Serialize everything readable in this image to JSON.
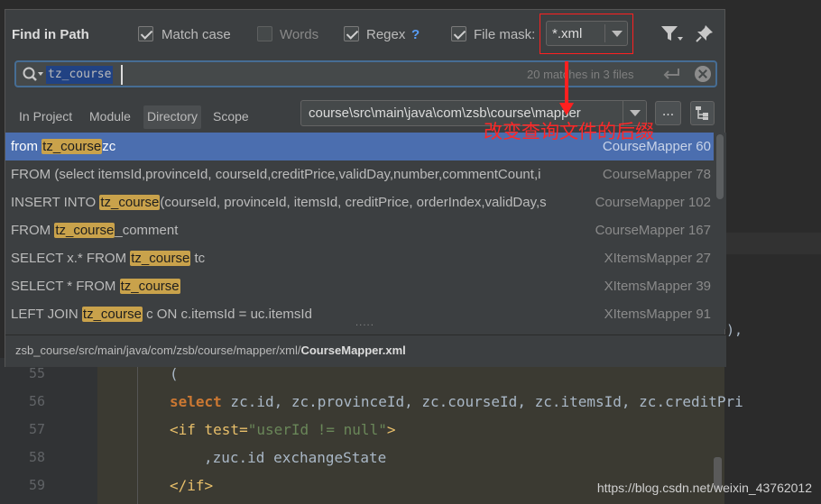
{
  "popup": {
    "title": "Find in Path",
    "options": [
      {
        "label": "Match case",
        "checked": true
      },
      {
        "label": "Words",
        "checked": false
      },
      {
        "label": "Regex",
        "checked": true
      },
      {
        "label": "File mask:",
        "checked": true
      }
    ],
    "regex_help": "?",
    "file_mask_value": "*.xml",
    "search": {
      "query": "tz_course",
      "count": "20 matches in 3 files"
    },
    "scopes": [
      {
        "label": "In Project",
        "selected": false
      },
      {
        "label": "Module",
        "selected": false
      },
      {
        "label": "Directory",
        "selected": true
      },
      {
        "label": "Scope",
        "selected": false
      }
    ],
    "directory_value": "course\\src\\main\\java\\com\\zsb\\course\\mapper",
    "browse_label": "...",
    "results": [
      {
        "pre": "from ",
        "match": "tz_course",
        "post": "zc",
        "file": "CourseMapper 60"
      },
      {
        "pre": "FROM (select itemsId,provinceId, courseId,creditPrice,validDay,number,commentCount,i",
        "match": "",
        "post": "",
        "file": "CourseMapper 78"
      },
      {
        "pre": "INSERT INTO ",
        "match": "tz_course",
        "post": "(courseId, provinceId, itemsId, creditPrice, orderIndex,validDay,s",
        "file": "CourseMapper 102"
      },
      {
        "pre": "FROM ",
        "match": "tz_course",
        "post": "_comment",
        "file": "CourseMapper 167"
      },
      {
        "pre": "SELECT x.* FROM ",
        "match": "tz_course",
        "post": " tc",
        "file": "XItemsMapper 27"
      },
      {
        "pre": "SELECT * FROM ",
        "match": "tz_course",
        "post": "",
        "file": "XItemsMapper 39"
      },
      {
        "pre": "LEFT JOIN ",
        "match": "tz_course",
        "post": " c ON c.itemsId = uc.itemsId",
        "file": "XItemsMapper 91"
      }
    ],
    "path_prefix": "zsb_course/src/main/java/com/zsb/course/mapper/xml/",
    "path_file": "CourseMapper.xml"
  },
  "annotation": "改变查询文件的后缀",
  "editor": {
    "trailing": "),",
    "lines": [
      {
        "num": "55",
        "text": "("
      },
      {
        "num": "56",
        "kw": "select",
        "text": " zc.id, zc.provinceId, zc.courseId, zc.itemsId, zc.creditPri"
      },
      {
        "num": "57",
        "tag_open": "<if test=",
        "attr": "\"userId != null\"",
        "tag_close": ">"
      },
      {
        "num": "58",
        "text": ",zuc.id exchangeState"
      },
      {
        "num": "59",
        "tag_open": "</if>"
      }
    ]
  },
  "watermark": "https://blog.csdn.net/weixin_43762012",
  "colors": {
    "accent": "#4b6eaf",
    "highlight": "#c9a24b",
    "annotation": "#ff2828"
  }
}
